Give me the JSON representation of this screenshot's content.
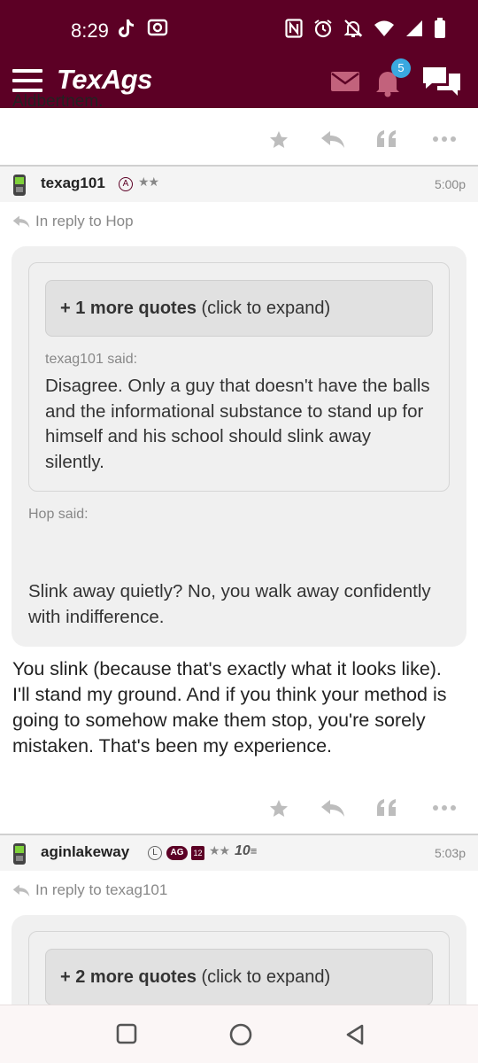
{
  "status_bar": {
    "time": "8:29",
    "left_icons": [
      "tiktok-icon",
      "screenshot-icon"
    ],
    "right_icons": [
      "nfc-icon",
      "alarm-icon",
      "mute-icon",
      "wifi-icon",
      "signal-icon",
      "battery-icon"
    ]
  },
  "header": {
    "logo": "TexAgs",
    "notification_count": "5",
    "brand_color": "#5c0025",
    "badge_color": "#3aa8e0"
  },
  "top_cutoff_text": "Aldbertnem.",
  "posts": [
    {
      "username": "texag101",
      "badges": [
        "A"
      ],
      "stars": "★★",
      "time": "5:00p",
      "in_reply_to": "In reply to Hop",
      "more_quotes_bold": "+ 1 more quotes",
      "more_quotes_rest": " (click to expand)",
      "inner_said": "texag101 said:",
      "inner_text": "Disagree. Only a guy that doesn't have the balls and the informational substance to stand up for himself and his school should slink away silently.",
      "outer_said": "Hop said:",
      "outer_text": "Slink away quietly? No, you walk away confidently with indifference.",
      "body": "You slink (because that's exactly what it looks like). I'll stand my ground. And if you think your method is going to somehow make them stop, you're sorely mistaken. That's been my experience."
    },
    {
      "username": "aginlakeway",
      "badges": [
        "L",
        "AG",
        "12"
      ],
      "stars": "★★",
      "tenx": "10",
      "time": "5:03p",
      "in_reply_to": "In reply to texag101",
      "more_quotes_bold": "+ 2 more quotes",
      "more_quotes_rest": " (click to expand)"
    }
  ],
  "actions": [
    "star-icon",
    "reply-icon",
    "quote-icon",
    "more-icon"
  ],
  "nav": [
    "recents-button",
    "home-button",
    "back-button"
  ]
}
